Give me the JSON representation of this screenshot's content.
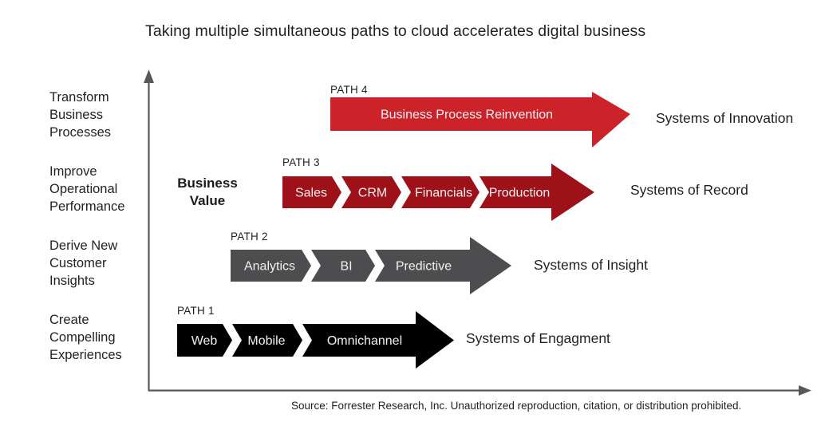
{
  "title": "Taking multiple simultaneous paths to cloud accelerates digital business",
  "axis": {
    "y_caption_line1": "Business",
    "y_caption_line2": "Value"
  },
  "stage_labels": [
    {
      "line1": "Transform",
      "line2": "Business",
      "line3": "Processes"
    },
    {
      "line1": "Improve",
      "line2": "Operational",
      "line3": "Performance"
    },
    {
      "line1": "Derive New",
      "line2": "Customer",
      "line3": "Insights"
    },
    {
      "line1": "Create",
      "line2": "Compelling",
      "line3": "Experiences"
    }
  ],
  "paths": [
    {
      "tag": "PATH 4",
      "color": "#cc2229",
      "system_label": "Systems of Innovation",
      "segments": [
        "Business Process Reinvention"
      ]
    },
    {
      "tag": "PATH 3",
      "color": "#9e1119",
      "system_label": "Systems of Record",
      "segments": [
        "Sales",
        "CRM",
        "Financials",
        "Production"
      ]
    },
    {
      "tag": "PATH 2",
      "color": "#4d4d4f",
      "system_label": "Systems of Insight",
      "segments": [
        "Analytics",
        "BI",
        "Predictive"
      ]
    },
    {
      "tag": "PATH 1",
      "color": "#000000",
      "system_label": "Systems of Engagment",
      "segments": [
        "Web",
        "Mobile",
        "Omnichannel"
      ]
    }
  ],
  "source": "Source: Forrester Research, Inc. Unauthorized reproduction, citation, or distribution prohibited.",
  "colors": {
    "axis": "#58585b",
    "background": "#ffffff",
    "text": "#231f20",
    "segment_text": "#f2f2f2"
  }
}
